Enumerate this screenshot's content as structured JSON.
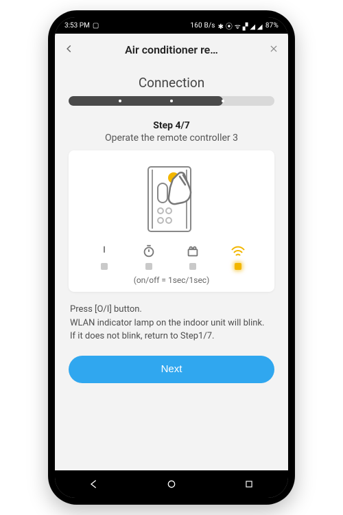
{
  "statusbar": {
    "time": "3:53 PM",
    "net_rate": "160 B/s",
    "icons_text": "✱ ⦿ ᯤ ▞ ◢ ◢",
    "battery_text": "87%"
  },
  "header": {
    "title": "Air conditioner re…"
  },
  "section": {
    "heading": "Connection",
    "progress_percent": 75,
    "total_steps": 7
  },
  "step": {
    "label": "Step 4/7",
    "subtitle": "Operate the remote controller 3",
    "timing_caption": "(on/off = 1sec/1sec)"
  },
  "indicators": {
    "power": {
      "name": "power-indicator",
      "active": false
    },
    "timer": {
      "name": "timer-indicator",
      "active": false
    },
    "mode": {
      "name": "mode-indicator",
      "active": false
    },
    "wifi": {
      "name": "wifi-indicator",
      "active": true
    }
  },
  "instructions": {
    "line1": "Press [O/I] button.",
    "line2": "WLAN indicator lamp on the indoor unit will blink.",
    "line3": "If it does not blink, return to Step1/7."
  },
  "buttons": {
    "next": "Next"
  }
}
